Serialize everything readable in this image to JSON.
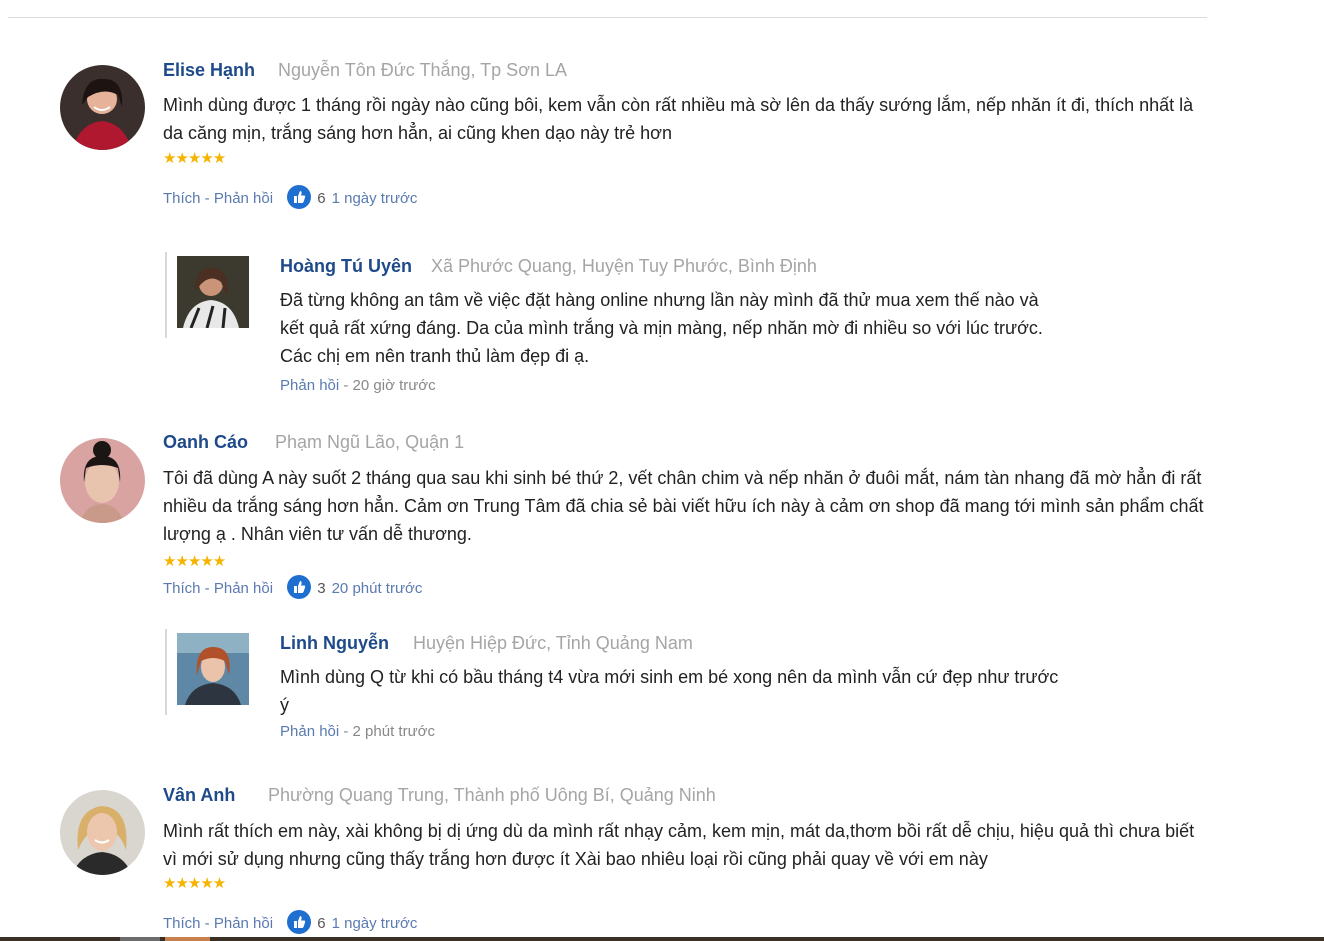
{
  "comments": [
    {
      "name": "Elise Hạnh",
      "location": "Nguyễn Tôn Đức Thắng, Tp Sơn LA",
      "text": "Mình dùng được 1 tháng rồi ngày nào cũng bôi, kem vẫn còn rất nhiều mà sờ lên da thấy sướng lắm, nếp nhăn ít đi, thích nhất là da căng mịn, trắng sáng hơn hẳn, ai cũng khen dạo này trẻ hơn",
      "stars": "★★★★★",
      "rating": 5,
      "like_label": "Thích",
      "reply_label": "Phản hồi",
      "sep": " - ",
      "like_count": "6",
      "time": "1 ngày trước",
      "reply": {
        "name": "Hoàng Tú Uyên",
        "location": "Xã Phước Quang, Huyện Tuy Phước, Bình Định",
        "text": "Đã từng không an tâm về việc đặt hàng online nhưng lần này mình đã thử mua xem thế nào và kết quả rất xứng đáng. Da của mình trắng và mịn màng, nếp nhăn mờ đi nhiều so với lúc trước. Các chị em nên tranh thủ làm đẹp đi ạ.",
        "reply_label": "Phản hồi",
        "time": " - 20 giờ trước"
      }
    },
    {
      "name": "Oanh Cáo",
      "location": "Phạm Ngũ Lão, Quận 1",
      "text": "Tôi đã dùng A này suốt 2 tháng qua sau khi sinh bé thứ 2, vết chân chim và nếp nhăn ở đuôi mắt, nám tàn nhang đã mờ hẳn đi rất nhiều da trắng sáng hơn hẳn. Cảm ơn Trung Tâm đã chia sẻ bài viết hữu ích này à cảm ơn shop đã mang tới mình sản phẩm chất lượng ạ . Nhân viên tư vấn dễ thương.",
      "stars": "★★★★★",
      "rating": 5,
      "like_label": "Thích",
      "reply_label": "Phản hồi",
      "sep": " - ",
      "like_count": "3",
      "time": "20 phút trước",
      "reply": {
        "name": "Linh Nguyễn",
        "location": "Huyện Hiệp Đức, Tỉnh Quảng Nam",
        "text": "Mình dùng Q từ khi có bầu tháng t4 vừa mới sinh em bé xong nên da mình vẫn cứ đẹp như trước ý",
        "reply_label": "Phản hồi",
        "time": " - 2 phút trước"
      }
    },
    {
      "name": "Vân Anh",
      "location": "Phường Quang Trung, Thành phố Uông Bí, Quảng Ninh",
      "text": "Mình rất thích em này, xài không bị dị ứng dù da mình rất nhạy cảm, kem mịn, mát da,thơm bồi rất dễ chịu, hiệu quả thì chưa biết vì mới sử dụng nhưng cũng thấy trắng hơn được ít Xài bao nhiêu loại rồi cũng phải quay về với em này",
      "stars": "★★★★★",
      "rating": 5,
      "like_label": "Thích",
      "reply_label": "Phản hồi",
      "sep": " - ",
      "like_count": "6",
      "time": "1 ngày trước"
    }
  ],
  "icons": {
    "like": "thumbs-up-icon",
    "star": "star-icon"
  },
  "colors": {
    "name": "#1e4a8a",
    "location": "#a5a5a5",
    "link": "#5a7ab0",
    "star": "#f5b400",
    "like_badge": "#1f6fd1"
  }
}
